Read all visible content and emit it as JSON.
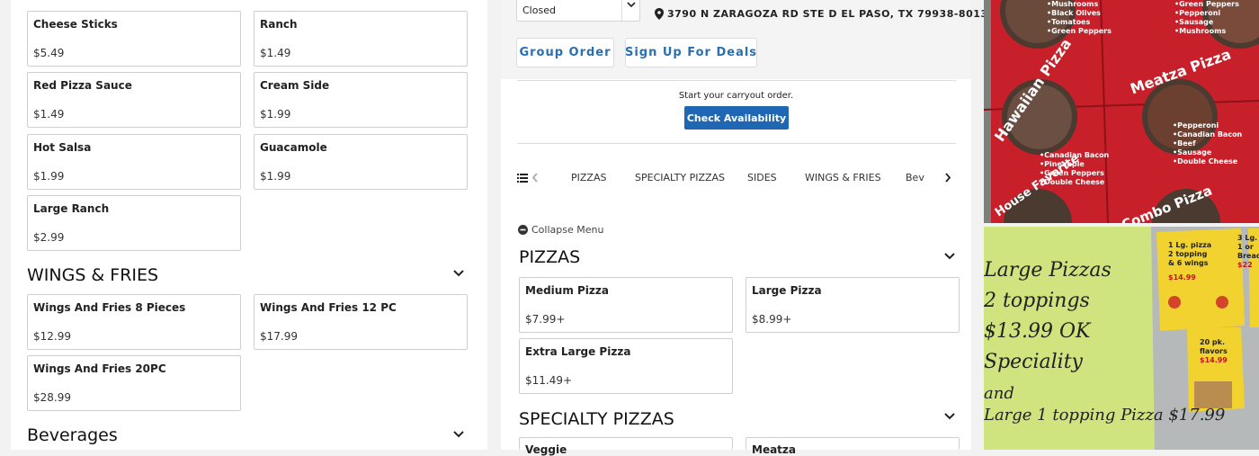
{
  "left": {
    "addons": [
      {
        "name": "Cheese Sticks",
        "price": "$5.49"
      },
      {
        "name": "Ranch",
        "price": "$1.49"
      },
      {
        "name": "Red Pizza Sauce",
        "price": "$1.49"
      },
      {
        "name": "Cream Side",
        "price": "$1.99"
      },
      {
        "name": "Hot Salsa",
        "price": "$1.99"
      },
      {
        "name": "Guacamole",
        "price": "$1.99"
      },
      {
        "name": "Large Ranch",
        "price": "$2.99"
      }
    ],
    "wings_title": "WINGS & FRIES",
    "wings": [
      {
        "name": "Wings And Fries 8 Pieces",
        "price": "$12.99"
      },
      {
        "name": "Wings And Fries 12 PC",
        "price": "$17.99"
      },
      {
        "name": "Wings And Fries 20PC",
        "price": "$28.99"
      }
    ],
    "beverages_title": "Beverages"
  },
  "header": {
    "hours_status": "Closed",
    "address": "3790 N ZARAGOZA RD STE D EL PASO, TX 79938-8013",
    "group_order_label": "Group Order",
    "deals_label": "Sign Up For Deals"
  },
  "carryout": {
    "prompt": "Start your carryout order.",
    "check_label": "Check Availability"
  },
  "categories": [
    "PIZZAS",
    "SPECIALTY PIZZAS",
    "SIDES",
    "WINGS & FRIES",
    "Bev"
  ],
  "menu": {
    "collapse_label": "Collapse Menu",
    "pizzas_title": "PIZZAS",
    "pizzas": [
      {
        "name": "Medium Pizza",
        "price": "$7.99+"
      },
      {
        "name": "Large Pizza",
        "price": "$8.99+"
      },
      {
        "name": "Extra Large Pizza",
        "price": "$11.49+"
      }
    ],
    "specialty_title": "SPECIALTY PIZZAS",
    "specialty": [
      {
        "name": "Veggie"
      },
      {
        "name": "Meatza"
      }
    ]
  },
  "photos": {
    "top_poster": {
      "hawaiian_title": "Hawaiian Pizza",
      "hawaiian_toppings": [
        "•Canadian Bacon",
        "•Pineapple",
        "•Green Peppers",
        "•Double Cheese"
      ],
      "meatza_title": "Meatza Pizza",
      "meatza_toppings": [
        "•Pepperoni",
        "•Canadian Bacon",
        "•Beef",
        "•Sausage",
        "•Double Cheese"
      ],
      "top_left_toppings": [
        "•Mushrooms",
        "•Black Olives",
        "•Tomatoes",
        "•Green Peppers"
      ],
      "top_right_toppings": [
        "•Green Peppers",
        "•Pepperoni",
        "•Sausage",
        "•Mushrooms"
      ],
      "house_title": "House Favorite",
      "combo_title": "Combo Pizza"
    },
    "bottom_sign": {
      "lines": [
        "Large Pizzas",
        "2 toppings",
        "$13.99  OK",
        "Speciality",
        "and",
        "Large 1 topping Pizza $17.99"
      ],
      "flyer1": [
        "1 Lg. pizza",
        "2 topping",
        "& 6 wings",
        "$14.99"
      ],
      "flyer2": [
        "20 pk.",
        "flavors",
        "$14.99"
      ],
      "flyer3": [
        "3 Lg.",
        "1 or",
        "Bread",
        "$22"
      ]
    }
  },
  "colors": {
    "accent": "#2a6fb0",
    "button_bg": "#1f66b3",
    "poster_red": "#c8202a",
    "sign_green": "#c7d98a",
    "flyer_yellow": "#f2d22e"
  }
}
